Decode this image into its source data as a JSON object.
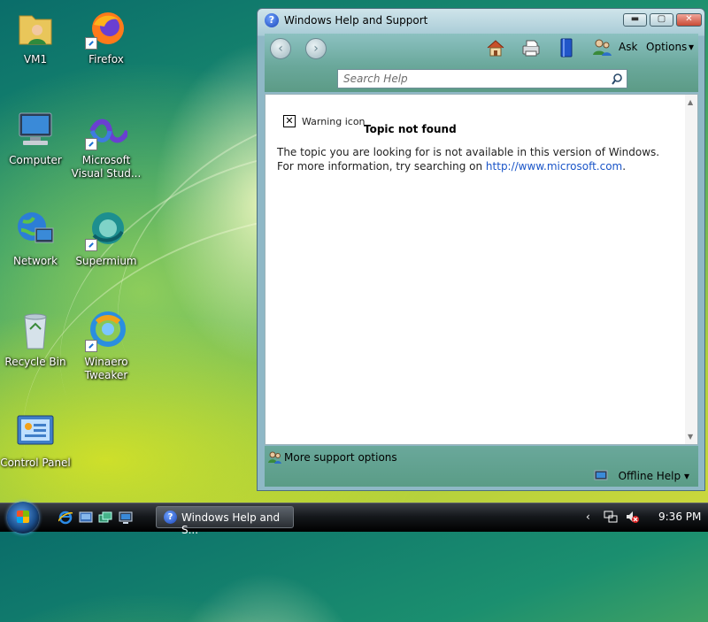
{
  "desktop": {
    "icons": [
      {
        "label": "VM1",
        "icon": "user-folder-icon"
      },
      {
        "label": "Firefox",
        "icon": "firefox-icon"
      },
      {
        "label": "Computer",
        "icon": "computer-icon"
      },
      {
        "label": "Microsoft Visual Stud...",
        "icon": "visual-studio-icon"
      },
      {
        "label": "Network",
        "icon": "network-icon"
      },
      {
        "label": "Supermium",
        "icon": "supermium-icon"
      },
      {
        "label": "Recycle Bin",
        "icon": "recycle-bin-icon"
      },
      {
        "label": "Winaero Tweaker",
        "icon": "winaero-tweaker-icon"
      },
      {
        "label": "Control Panel",
        "icon": "control-panel-icon"
      }
    ]
  },
  "window": {
    "title": "Windows Help and Support",
    "controls": {
      "minimize": "▬",
      "maximize": "▢",
      "close": "✕"
    },
    "toolbar": {
      "back": "‹",
      "forward": "›",
      "ask_label": "Ask",
      "options_label": "Options",
      "options_arrow": "▾"
    },
    "search": {
      "placeholder": "Search Help"
    },
    "content": {
      "warning_icon_label": "Warning icon",
      "warning_mark": "✕",
      "topic_title": "Topic not found",
      "body_prefix": "The topic you are looking for is not available in this version of Windows. For more information, try searching on",
      "body_link": "http://www.microsoft.com",
      "body_suffix": "."
    },
    "footer": {
      "more_support": "More support options",
      "offline_help": "Offline Help",
      "offline_arrow": "▾"
    }
  },
  "taskbar": {
    "task_title": "Windows Help and S...",
    "tray_chevron": "‹",
    "clock": "9:36 PM"
  },
  "colors": {
    "link": "#1a55c8",
    "toolbar_teal": "#6aa89b",
    "taskbar": "#15181c"
  }
}
